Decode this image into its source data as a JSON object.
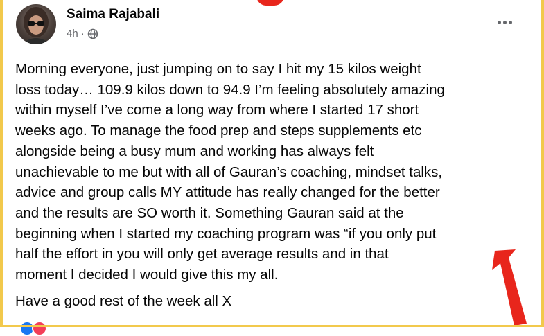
{
  "post": {
    "author": "Saima Rajabali",
    "time": "4h",
    "separator": "·",
    "audience_icon": "globe-icon",
    "more_icon": "more-horizontal-icon",
    "body": "Morning everyone, just jumping on to say I hit my 15 kilos weight\nloss today… 109.9 kilos down to 94.9 I’m feeling absolutely amazing\nwithin myself I’ve come a long way from where I started 17 short\nweeks ago. To manage the food prep and steps supplements etc\nalongside being a busy mum and working has always felt\nunachievable to me but with all of Gauran’s coaching, mindset talks,\nadvice and group calls MY attitude has really changed for the better\nand the results are SO worth it. Something Gauran said at the\nbeginning when I started my coaching program was “if you only put\nhalf the effort in you will only get average results and in that\nmoment I decided I would give this my all.",
    "closing": "Have a good rest of the week all X",
    "reactions": [
      "like-reaction-icon",
      "love-reaction-icon"
    ]
  },
  "colors": {
    "frame_border": "#f2c94c",
    "annotation_arrow": "#e8261c",
    "text": "#050505",
    "secondary_text": "#65676b"
  }
}
